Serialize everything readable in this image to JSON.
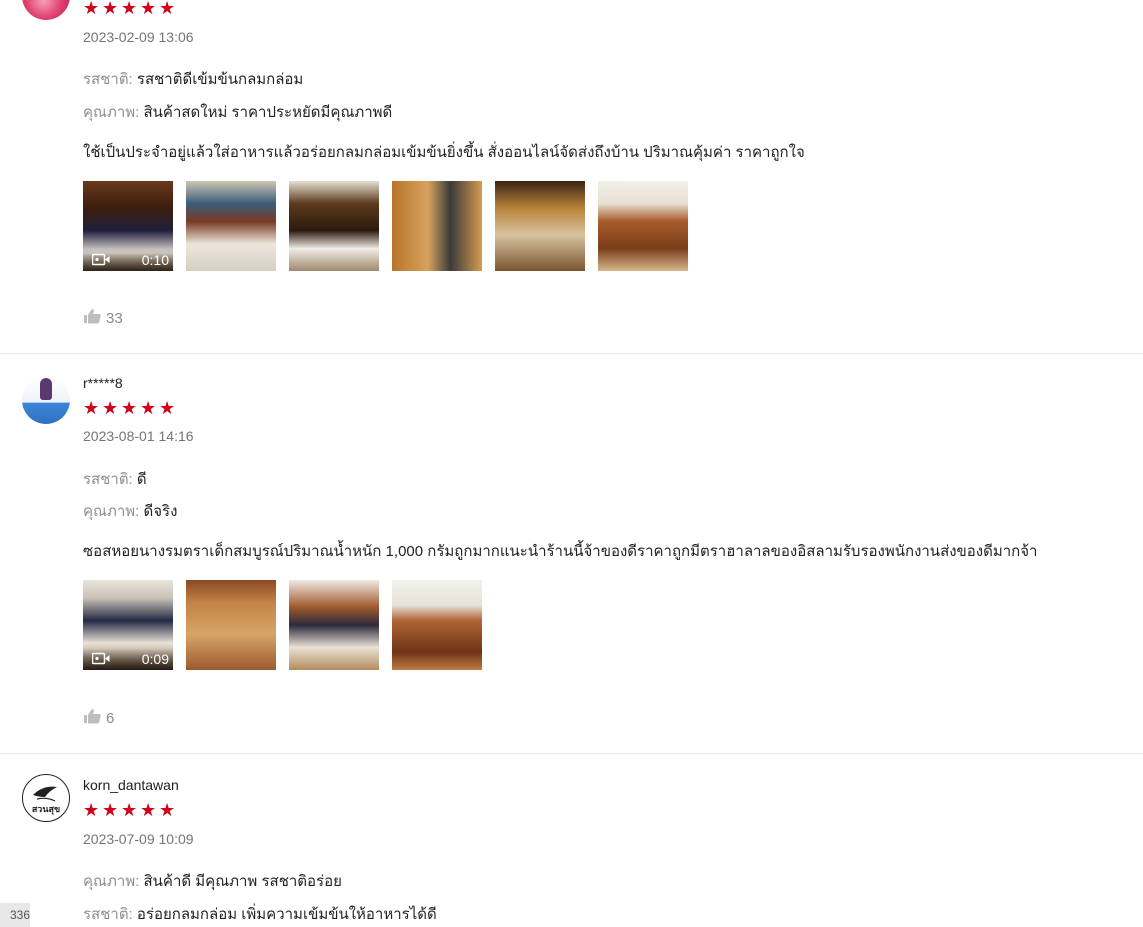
{
  "reviews": [
    {
      "username": "",
      "rating": 5,
      "date": "2023-02-09 13:06",
      "attributes": [
        {
          "label": "รสชาติ:",
          "value": "รสชาติดีเข้มข้นกลมกล่อม"
        },
        {
          "label": "คุณภาพ:",
          "value": "สินค้าสดใหม่ ราคาประหยัดมีคุณภาพดี"
        }
      ],
      "comment": "ใช้เป็นประจำอยู่แล้วใส่อาหารแล้วอร่อยกลมกล่อมเข้มข้นยิ่งขึ้น สั่งออนไลน์จัดส่งถึงบ้าน ปริมาณคุ้มค่า ราคาถูกใจ",
      "video_duration": "0:10",
      "likes": "33"
    },
    {
      "username": "r*****8",
      "rating": 5,
      "date": "2023-08-01 14:16",
      "attributes": [
        {
          "label": "รสชาติ:",
          "value": "ดี"
        },
        {
          "label": "คุณภาพ:",
          "value": "ดีจริง"
        }
      ],
      "comment": "ซอสหอยนางรมตราเด็กสมบูรณ์ปริมาณน้ำหนัก 1,000 กรัมถูกมากแนะนำร้านนี้จ้าของดีราคาถูกมีตราฮาลาลของอิสลามรับรองพนักงานส่งของดีมากจ้า",
      "video_duration": "0:09",
      "likes": "6"
    },
    {
      "username": "korn_dantawan",
      "rating": 5,
      "date": "2023-07-09 10:09",
      "attributes": [
        {
          "label": "คุณภาพ:",
          "value": "สินค้าดี มีคุณภาพ รสชาติอร่อย"
        },
        {
          "label": "รสชาติ:",
          "value": "อร่อยกลมกล่อม เพิ่มความเข้มข้นให้อาหารได้ดี"
        }
      ],
      "avatar_text": "สวนสุข"
    }
  ],
  "page_badge": "336",
  "colors": {
    "star": "#d0011b",
    "date": "#757575",
    "label": "#8f8f8f",
    "likes": "#8a8a8a"
  },
  "icons": {
    "star": "star-icon",
    "like": "thumbs-up-icon",
    "video": "video-camera-icon"
  }
}
